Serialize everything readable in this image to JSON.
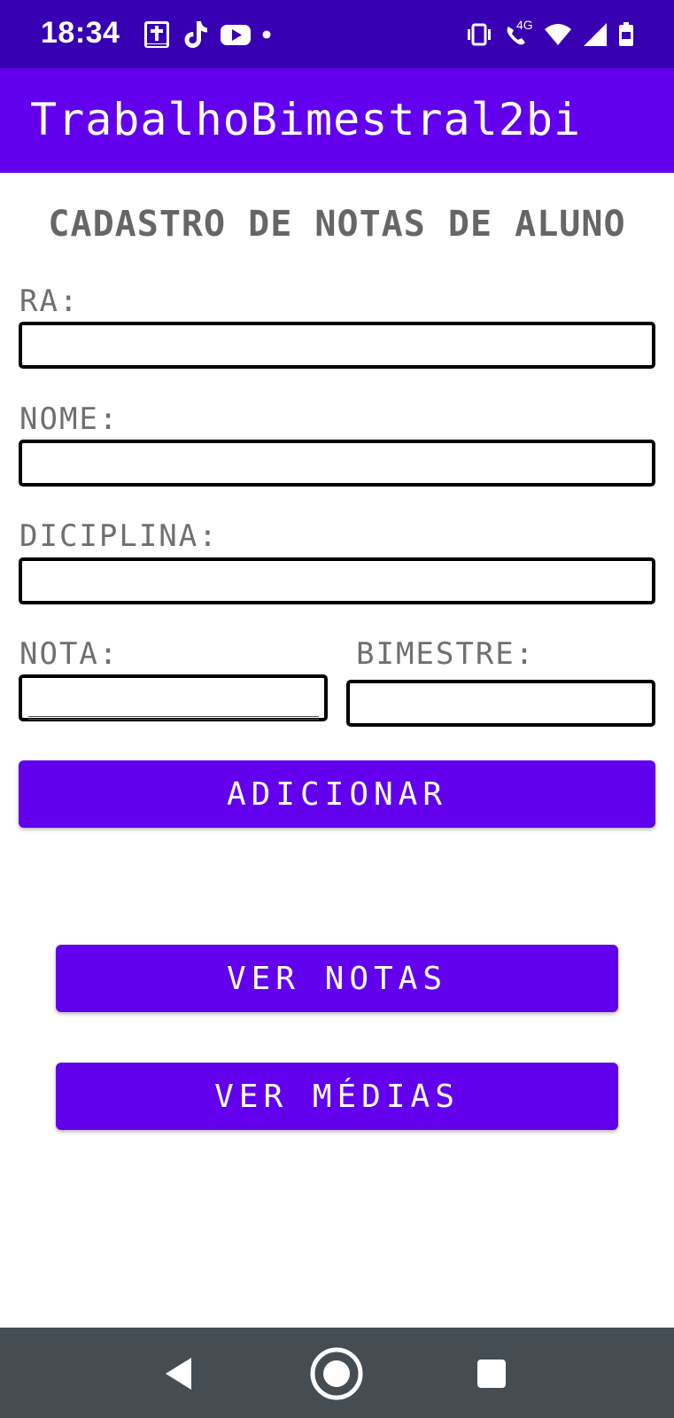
{
  "status_bar": {
    "time": "18:34",
    "left_icons": [
      "bible-app-icon",
      "tiktok-icon",
      "youtube-icon",
      "notification-dot-icon"
    ],
    "network_label": "4G",
    "right_icons": [
      "vibrate-icon",
      "wifi-calling-icon",
      "wifi-icon",
      "signal-icon",
      "battery-icon"
    ]
  },
  "app_bar": {
    "title": "TrabalhoBimestral2bi"
  },
  "form": {
    "title": "CADASTRO DE NOTAS DE ALUNO",
    "ra": {
      "label": "RA:",
      "value": ""
    },
    "nome": {
      "label": "NOME:",
      "value": ""
    },
    "disciplina": {
      "label": "DICIPLINA:",
      "value": ""
    },
    "nota": {
      "label": "NOTA:",
      "value": ""
    },
    "bimestre": {
      "label": "BIMESTRE:",
      "value": ""
    }
  },
  "buttons": {
    "adicionar": "ADICIONAR",
    "ver_notas": "VER NOTAS",
    "ver_medias": "VER MÉDIAS"
  },
  "nav_bar": {
    "icons": [
      "back-icon",
      "home-icon",
      "recents-icon"
    ]
  },
  "colors": {
    "status_bar": "#3700b3",
    "primary": "#6200ee",
    "label_text": "#707070",
    "nav_bar": "#454d53"
  }
}
